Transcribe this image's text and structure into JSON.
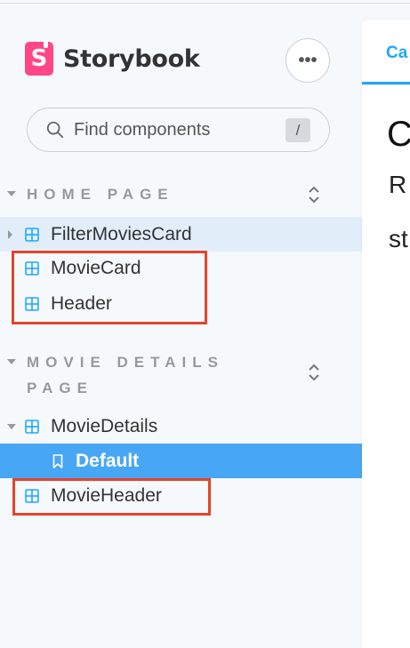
{
  "brand": {
    "name": "Storybook",
    "logo_letter": "S"
  },
  "menu_button": {
    "label": "•••"
  },
  "search": {
    "placeholder": "Find components",
    "shortcut": "/"
  },
  "groups": [
    {
      "title": "HOME PAGE",
      "items": [
        {
          "label": "FilterMoviesCard",
          "state": "hovered"
        },
        {
          "label": "MovieCard"
        },
        {
          "label": "Header"
        }
      ]
    },
    {
      "title": "MOVIE DETAILS PAGE",
      "items": [
        {
          "label": "MovieDetails",
          "expanded": true,
          "children": [
            {
              "label": "Default",
              "selected": true
            }
          ]
        },
        {
          "label": "MovieHeader"
        }
      ]
    }
  ],
  "main": {
    "tab_label": "Ca",
    "heading": "C",
    "text_lines": [
      "R",
      "st"
    ]
  },
  "colors": {
    "accent": "#1ea7fd",
    "selected": "#48a7f5",
    "brand": "#ff4785",
    "highlight": "#e4432c"
  }
}
